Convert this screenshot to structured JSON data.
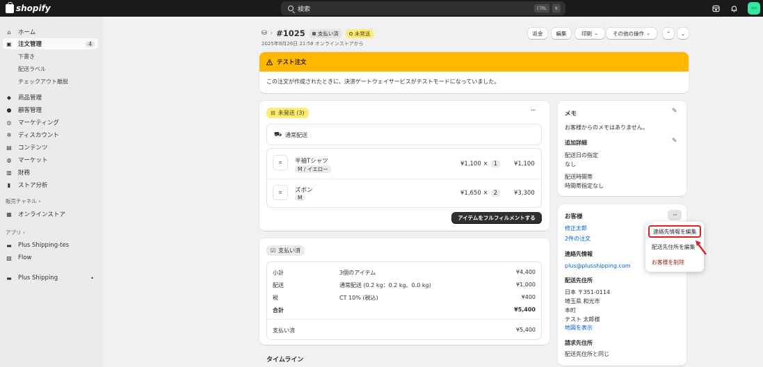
{
  "topbar": {
    "brand": "shopify",
    "search_placeholder": "検索",
    "shortcut_ctrl": "CTRL",
    "shortcut_k": "K",
    "avatar": "spe",
    "icons": [
      "store-icon",
      "bell-icon"
    ]
  },
  "sidebar": {
    "items": [
      {
        "label": "ホーム",
        "icon": "home-icon"
      },
      {
        "label": "注文管理",
        "icon": "inbox-icon",
        "count": "4"
      },
      {
        "label": "商品管理",
        "icon": "tag-icon"
      },
      {
        "label": "顧客管理",
        "icon": "person-icon"
      },
      {
        "label": "マーケティング",
        "icon": "target-icon"
      },
      {
        "label": "ディスカウント",
        "icon": "discount-icon"
      },
      {
        "label": "コンテンツ",
        "icon": "content-icon"
      },
      {
        "label": "マーケット",
        "icon": "globe-icon"
      },
      {
        "label": "財務",
        "icon": "bank-icon"
      },
      {
        "label": "ストア分析",
        "icon": "chart-icon"
      }
    ],
    "order_subitems": [
      "下書き",
      "配送ラベル",
      "チェックアウト離脱"
    ],
    "sales_channels_heading": "販売チャネル",
    "online_store": "オンラインストア",
    "apps_heading": "アプリ",
    "apps": [
      "Plus Shipping-tes",
      "Flow"
    ],
    "plus_shipping": "Plus Shipping"
  },
  "header": {
    "order_id": "#1025",
    "payment_badge": "支払い済",
    "fulfillment_badge": "未発送",
    "subline": "2025年8月26日 21:58 オンラインストアから",
    "buttons": {
      "refund": "返金",
      "edit": "編集",
      "print": "印刷",
      "more": "その他の操作"
    }
  },
  "banner": {
    "title": "テスト注文",
    "body": "この注文が作成されたときに、決済ゲートウェイサービスがテストモードになっていました。"
  },
  "fulfillment": {
    "status": "未発送 (3)",
    "method": "通常配送",
    "items": [
      {
        "name": "半袖Tシャツ",
        "variant": "M / イエロー",
        "price": "¥1,100",
        "qty": "1",
        "total": "¥1,100"
      },
      {
        "name": "ズボン",
        "variant": "M",
        "price": "¥1,650",
        "qty": "2",
        "total": "¥3,300"
      }
    ],
    "action": "アイテムをフルフィルメントする",
    "times": "×"
  },
  "payment": {
    "status": "支払い済",
    "rows": [
      {
        "label": "小計",
        "detail": "3個のアイテム",
        "amount": "¥4,400"
      },
      {
        "label": "配送",
        "detail": "通常配送 (0.2 kg：0.2 kg、0.0 kg)",
        "amount": "¥1,000"
      },
      {
        "label": "税",
        "detail": "CT 10% (税込)",
        "amount": "¥400"
      },
      {
        "label": "合計",
        "detail": "",
        "amount": "¥5,400"
      }
    ],
    "paid_label": "支払い済",
    "paid_amount": "¥5,400"
  },
  "timeline": {
    "title": "タイムライン"
  },
  "notes": {
    "title": "メモ",
    "empty": "お客様からのメモはありません。",
    "extra_title": "追加詳細",
    "delivery_date_label": "配送日の指定",
    "delivery_date_value": "なし",
    "delivery_time_label": "配送時間帯",
    "delivery_time_value": "時間帯指定なし"
  },
  "customer": {
    "title": "お客様",
    "name": "修正太郎",
    "orders": "2件の注文",
    "contact_title": "連絡先情報",
    "email": "plus@plusshipping.com",
    "shipping_title": "配送先住所",
    "address_lines": [
      "日本 〒351-0114",
      "埼玉県 和光市",
      "本町",
      "テスト 太郎様"
    ],
    "map_link": "地図を表示",
    "billing_title": "請求先住所",
    "billing_value": "配送先住所と同じ"
  },
  "popover": {
    "edit_contact": "連絡先情報を編集",
    "edit_address": "配送先住所を編集",
    "remove_customer": "お客様を削除"
  },
  "colors": {
    "banner": "#ffb800",
    "highlight": "#e01b24",
    "link": "#005bd3"
  }
}
